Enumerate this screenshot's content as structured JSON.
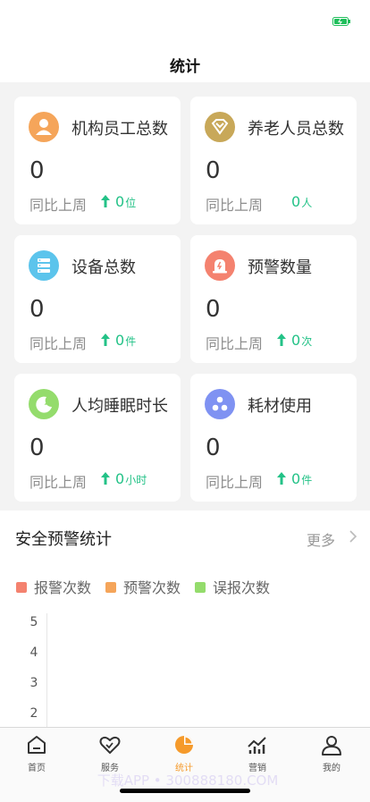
{
  "nav": {
    "title": "统计"
  },
  "cards": [
    {
      "label": "机构员工总数",
      "value": "0",
      "compare": "同比上周",
      "delta": "0",
      "unit": "位",
      "arrow": true,
      "icon": "person-icon",
      "color": "#f5a55a"
    },
    {
      "label": "养老人员总数",
      "value": "0",
      "compare": "同比上周",
      "delta": "0",
      "unit": "人",
      "arrow": false,
      "icon": "heart-diamond-icon",
      "color": "#c8a859"
    },
    {
      "label": "设备总数",
      "value": "0",
      "compare": "同比上周",
      "delta": "0",
      "unit": "件",
      "arrow": true,
      "icon": "device-list-icon",
      "color": "#5cc4ec"
    },
    {
      "label": "预警数量",
      "value": "0",
      "compare": "同比上周",
      "delta": "0",
      "unit": "次",
      "arrow": true,
      "icon": "alarm-icon",
      "color": "#f4826f"
    },
    {
      "label": "人均睡眠时长",
      "value": "0",
      "compare": "同比上周",
      "delta": "0",
      "unit": "小时",
      "arrow": true,
      "icon": "moon-icon",
      "color": "#94dc6c"
    },
    {
      "label": "耗材使用",
      "value": "0",
      "compare": "同比上周",
      "delta": "0",
      "unit": "件",
      "arrow": true,
      "icon": "dots-icon",
      "color": "#7f92f2"
    }
  ],
  "panel": {
    "title": "安全预警统计",
    "more": "更多",
    "legend": [
      {
        "label": "报警次数",
        "color": "#f4826f"
      },
      {
        "label": "预警次数",
        "color": "#f5a55a"
      },
      {
        "label": "误报次数",
        "color": "#94dc6c"
      }
    ],
    "y_ticks": [
      "5",
      "4",
      "3",
      "2"
    ]
  },
  "tabs": [
    {
      "label": "首页",
      "icon": "home-icon",
      "active": false
    },
    {
      "label": "服务",
      "icon": "heart-hand-icon",
      "active": false
    },
    {
      "label": "统计",
      "icon": "pie-chart-icon",
      "active": true
    },
    {
      "label": "营销",
      "icon": "trend-chart-icon",
      "active": false
    },
    {
      "label": "我的",
      "icon": "user-icon",
      "active": false
    }
  ],
  "watermark": "下载APP • 300888180.COM"
}
